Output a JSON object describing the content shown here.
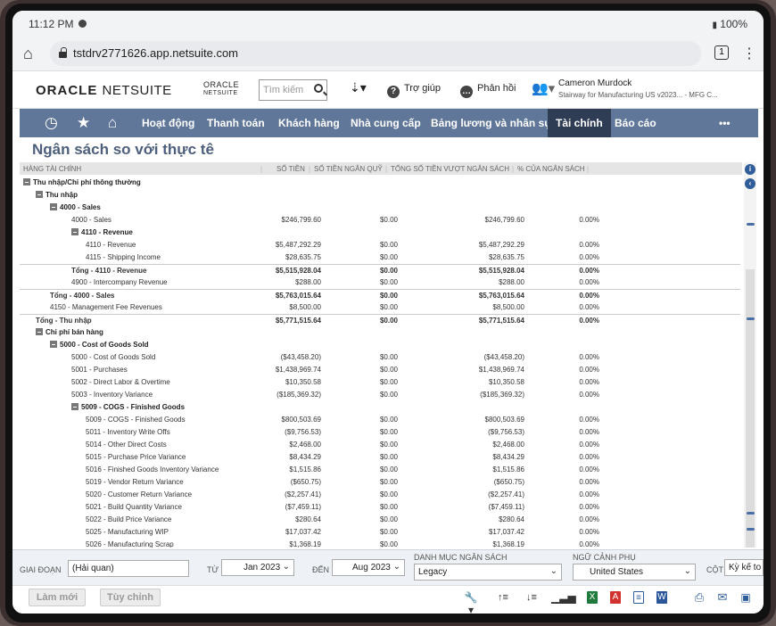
{
  "status": {
    "time": "11:12 PM",
    "battery": "100%"
  },
  "browser": {
    "url": "tstdrv2771626.app.netsuite.com",
    "tab_count": "1"
  },
  "header": {
    "logo_oracle": "ORACLE",
    "logo_netsuite": "NETSUITE",
    "small_oracle": "ORACLE",
    "small_netsuite": "NETSUITE",
    "search_placeholder": "Tìm kiếm",
    "help_label": "Trợ giúp",
    "feedback_label": "Phản hồi",
    "user_name": "Cameron Murdock",
    "user_role": "Stairway for Manufacturing US v2023... - MFG C..."
  },
  "nav": {
    "items": [
      "Hoạt động",
      "Thanh toán",
      "Khách hàng",
      "Nhà cung cấp",
      "Bảng lương và nhân sự",
      "Tài chính",
      "Báo cáo"
    ],
    "more": "•••",
    "active": "Tài chính"
  },
  "page": {
    "title": "Ngân sách so với thực tê"
  },
  "table": {
    "columns": [
      "HÀNG TÀI CHÍNH",
      "SỐ TIỀN",
      "SỐ TIỀN NGÂN QUỸ",
      "TỔNG SỐ TIỀN VƯỢT NGÂN SÁCH",
      "% CỦA NGÂN SÁCH"
    ],
    "rows": [
      {
        "label": "Thu nhập/Chi phí thông thường",
        "level": 0,
        "toggle": true,
        "kind": "grp",
        "a": "",
        "b": "",
        "c": "",
        "d": ""
      },
      {
        "label": "Thu nhập",
        "level": 1,
        "toggle": true,
        "kind": "grp",
        "a": "",
        "b": "",
        "c": "",
        "d": ""
      },
      {
        "label": "4000 - Sales",
        "level": 2,
        "toggle": true,
        "kind": "grp",
        "a": "",
        "b": "",
        "c": "",
        "d": ""
      },
      {
        "label": "4000 - Sales",
        "level": 3,
        "toggle": false,
        "kind": "",
        "a": "$246,799.60",
        "b": "$0.00",
        "c": "$246,799.60",
        "d": "0.00%"
      },
      {
        "label": "4110 - Revenue",
        "level": 3,
        "toggle": true,
        "kind": "grp",
        "a": "",
        "b": "",
        "c": "",
        "d": ""
      },
      {
        "label": "4110 - Revenue",
        "level": 4,
        "toggle": false,
        "kind": "",
        "a": "$5,487,292.29",
        "b": "$0.00",
        "c": "$5,487,292.29",
        "d": "0.00%"
      },
      {
        "label": "4115 - Shipping Income",
        "level": 4,
        "toggle": false,
        "kind": "",
        "a": "$28,635.75",
        "b": "$0.00",
        "c": "$28,635.75",
        "d": "0.00%"
      },
      {
        "label": "Tổng - 4110 - Revenue",
        "level": 3,
        "toggle": false,
        "kind": "total",
        "a": "$5,515,928.04",
        "b": "$0.00",
        "c": "$5,515,928.04",
        "d": "0.00%"
      },
      {
        "label": "4900 - Intercompany Revenue",
        "level": 3,
        "toggle": false,
        "kind": "",
        "a": "$288.00",
        "b": "$0.00",
        "c": "$288.00",
        "d": "0.00%"
      },
      {
        "label": "Tổng - 4000 - Sales",
        "level": 2,
        "toggle": false,
        "kind": "total",
        "a": "$5,763,015.64",
        "b": "$0.00",
        "c": "$5,763,015.64",
        "d": "0.00%"
      },
      {
        "label": "4150 - Management Fee Revenues",
        "level": 2,
        "toggle": false,
        "kind": "",
        "a": "$8,500.00",
        "b": "$0.00",
        "c": "$8,500.00",
        "d": "0.00%"
      },
      {
        "label": "Tổng - Thu nhập",
        "level": 1,
        "toggle": false,
        "kind": "total",
        "a": "$5,771,515.64",
        "b": "$0.00",
        "c": "$5,771,515.64",
        "d": "0.00%"
      },
      {
        "label": "Chi phí bán hàng",
        "level": 1,
        "toggle": true,
        "kind": "grp",
        "a": "",
        "b": "",
        "c": "",
        "d": ""
      },
      {
        "label": "5000 - Cost of Goods Sold",
        "level": 2,
        "toggle": true,
        "kind": "grp",
        "a": "",
        "b": "",
        "c": "",
        "d": ""
      },
      {
        "label": "5000 - Cost of Goods Sold",
        "level": 3,
        "toggle": false,
        "kind": "",
        "a": "($43,458.20)",
        "b": "$0.00",
        "c": "($43,458.20)",
        "d": "0.00%"
      },
      {
        "label": "5001 - Purchases",
        "level": 3,
        "toggle": false,
        "kind": "",
        "a": "$1,438,969.74",
        "b": "$0.00",
        "c": "$1,438,969.74",
        "d": "0.00%"
      },
      {
        "label": "5002 - Direct Labor & Overtime",
        "level": 3,
        "toggle": false,
        "kind": "",
        "a": "$10,350.58",
        "b": "$0.00",
        "c": "$10,350.58",
        "d": "0.00%"
      },
      {
        "label": "5003 - Inventory Variance",
        "level": 3,
        "toggle": false,
        "kind": "",
        "a": "($185,369.32)",
        "b": "$0.00",
        "c": "($185,369.32)",
        "d": "0.00%"
      },
      {
        "label": "5009 - COGS - Finished Goods",
        "level": 3,
        "toggle": true,
        "kind": "grp",
        "a": "",
        "b": "",
        "c": "",
        "d": ""
      },
      {
        "label": "5009 - COGS - Finished Goods",
        "level": 4,
        "toggle": false,
        "kind": "",
        "a": "$800,503.69",
        "b": "$0.00",
        "c": "$800,503.69",
        "d": "0.00%"
      },
      {
        "label": "5011 - Inventory Write Offs",
        "level": 4,
        "toggle": false,
        "kind": "",
        "a": "($9,756.53)",
        "b": "$0.00",
        "c": "($9,756.53)",
        "d": "0.00%"
      },
      {
        "label": "5014 - Other Direct Costs",
        "level": 4,
        "toggle": false,
        "kind": "",
        "a": "$2,468.00",
        "b": "$0.00",
        "c": "$2,468.00",
        "d": "0.00%"
      },
      {
        "label": "5015 - Purchase Price Variance",
        "level": 4,
        "toggle": false,
        "kind": "",
        "a": "$8,434.29",
        "b": "$0.00",
        "c": "$8,434.29",
        "d": "0.00%"
      },
      {
        "label": "5016 - Finished Goods Inventory Variance",
        "level": 4,
        "toggle": false,
        "kind": "",
        "a": "$1,515.86",
        "b": "$0.00",
        "c": "$1,515.86",
        "d": "0.00%"
      },
      {
        "label": "5019 - Vendor Return Variance",
        "level": 4,
        "toggle": false,
        "kind": "",
        "a": "($650.75)",
        "b": "$0.00",
        "c": "($650.75)",
        "d": "0.00%"
      },
      {
        "label": "5020 - Customer Return Variance",
        "level": 4,
        "toggle": false,
        "kind": "",
        "a": "($2,257.41)",
        "b": "$0.00",
        "c": "($2,257.41)",
        "d": "0.00%"
      },
      {
        "label": "5021 - Build Quantity Variance",
        "level": 4,
        "toggle": false,
        "kind": "",
        "a": "($7,459.11)",
        "b": "$0.00",
        "c": "($7,459.11)",
        "d": "0.00%"
      },
      {
        "label": "5022 - Build Price Variance",
        "level": 4,
        "toggle": false,
        "kind": "",
        "a": "$280.64",
        "b": "$0.00",
        "c": "$280.64",
        "d": "0.00%"
      },
      {
        "label": "5025 - Manufacturing WIP",
        "level": 4,
        "toggle": false,
        "kind": "",
        "a": "$17,037.42",
        "b": "$0.00",
        "c": "$17,037.42",
        "d": "0.00%"
      },
      {
        "label": "5026 - Manufacturing Scrap",
        "level": 4,
        "toggle": false,
        "kind": "",
        "a": "$1,368.19",
        "b": "$0.00",
        "c": "$1,368.19",
        "d": "0.00%"
      }
    ]
  },
  "filters": {
    "period_label": "GIAI ĐOẠN",
    "period_value": "(Hải quan)",
    "from_label": "TỪ",
    "from_value": "Jan 2023",
    "to_label": "ĐẾN",
    "to_value": "Aug 2023",
    "budget_label": "DANH MỤC NGÂN SÁCH",
    "budget_value": "Legacy",
    "context_label": "NGỮ CẢNH PHỤ",
    "context_value": "United States",
    "column_label": "CỘT",
    "column_value": "Kỳ kế to"
  },
  "footer": {
    "refresh_label": "Làm mới",
    "customize_label": "Tùy chỉnh"
  },
  "colors": {
    "nav": "#607799",
    "nav_active": "#2e3d53",
    "title": "#4d5f7c"
  }
}
